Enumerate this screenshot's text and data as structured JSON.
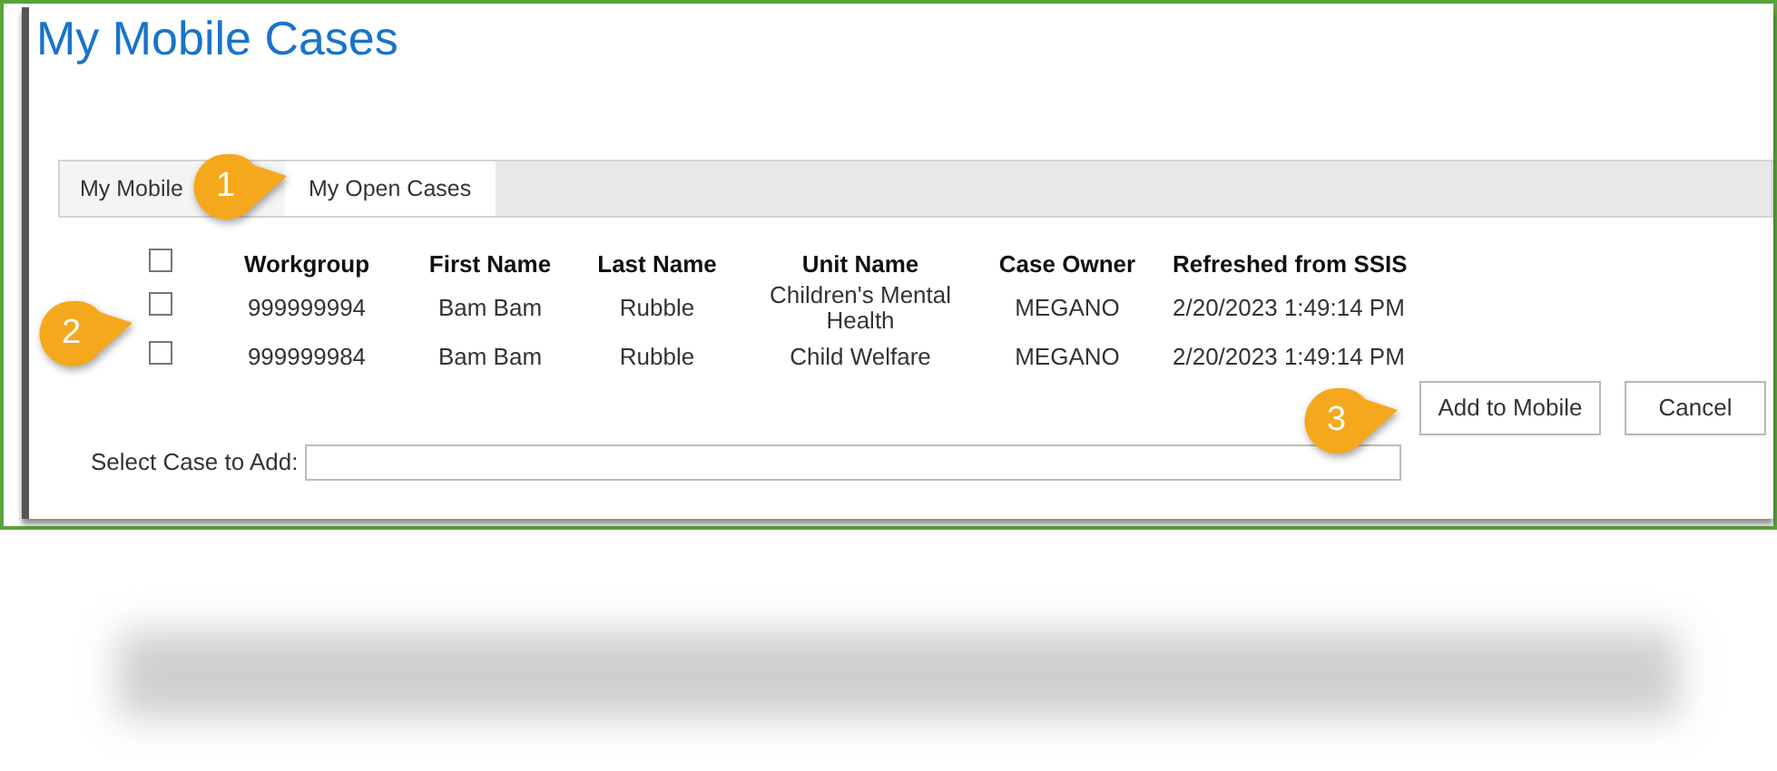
{
  "title": "My Mobile Cases",
  "tabs": [
    {
      "label": "My Mobile",
      "selected": false
    },
    {
      "label": "My Open Cases",
      "selected": true
    }
  ],
  "table": {
    "select_all": {
      "checked": false
    },
    "columns": [
      "Workgroup",
      "First Name",
      "Last Name",
      "Unit Name",
      "Case Owner",
      "Refreshed from SSIS"
    ],
    "rows": [
      {
        "checked": false,
        "cells": [
          "999999994",
          "Bam Bam",
          "Rubble",
          "Children's Mental Health",
          "MEGANO",
          "2/20/2023 1:49:14 PM"
        ]
      },
      {
        "checked": false,
        "cells": [
          "999999984",
          "Bam Bam",
          "Rubble",
          "Child Welfare",
          "MEGANO",
          "2/20/2023 1:49:14 PM"
        ]
      }
    ]
  },
  "buttons": [
    "Add to Mobile",
    "Cancel"
  ],
  "select_case": {
    "label": "Select Case to Add:"
  },
  "callouts": [
    "1",
    "2",
    "3"
  ]
}
